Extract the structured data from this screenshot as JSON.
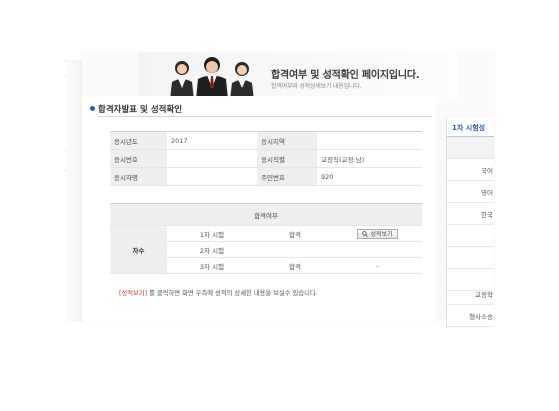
{
  "banner": {
    "title": "합격여부 및 성적확인 페이지입니다.",
    "subtitle": "합격여부와 성적상세보기 내용입니다."
  },
  "section": {
    "title": "합격자발표 및 성적확인"
  },
  "info": {
    "year_label": "응시년도",
    "year_value": "2017",
    "region_label": "응시지역",
    "region_value": "",
    "number_label": "응시번호",
    "number_value": "",
    "job_label": "응시직렬",
    "job_value": "교정직(교정:남)",
    "name_label": "응시자명",
    "name_value": "",
    "id_label": "주민번호",
    "id_value": "920"
  },
  "result": {
    "header": "합격여부",
    "round_label": "차수",
    "rows": [
      {
        "exam": "1차 시험",
        "status": "합격",
        "action": "성적보기"
      },
      {
        "exam": "2차 시험",
        "status": "",
        "action": ""
      },
      {
        "exam": "3차 시험",
        "status": "합격",
        "action": "-"
      }
    ]
  },
  "note": {
    "highlight": "[성적보기]",
    "text": "를 클릭하면 화면 우측에 성적의 상세한 내용을 보실수 있습니다."
  },
  "right_panel": {
    "title": "1차 시험성",
    "rows": [
      "",
      "국어",
      "영어",
      "한국",
      "",
      "",
      "",
      "교정학",
      "형사소송"
    ]
  },
  "icons": {
    "bullet": "blue-dot",
    "button_icon": "magnifier"
  },
  "colors": {
    "accent": "#2b5aa8",
    "header_bg": "#efefef",
    "highlight": "#c0392b"
  }
}
